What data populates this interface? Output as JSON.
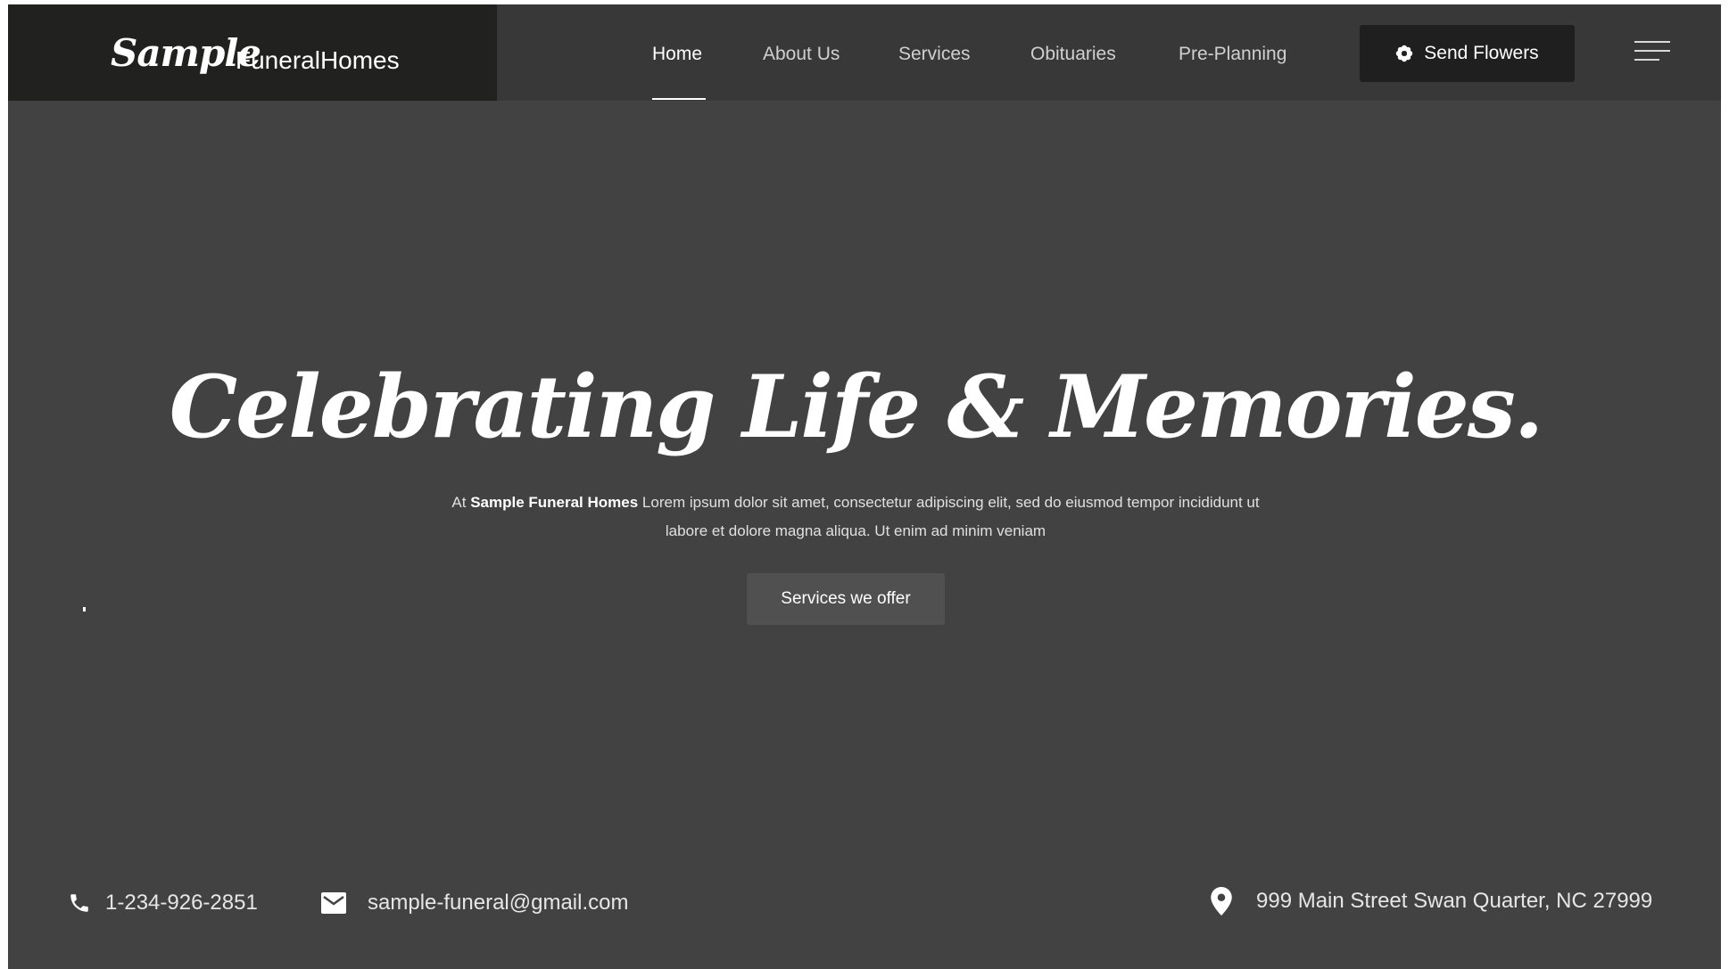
{
  "header": {
    "logo_script": "Sample",
    "logo_text": "FuneralHomes",
    "nav": [
      {
        "label": "Home",
        "active": true
      },
      {
        "label": "About Us"
      },
      {
        "label": "Services"
      },
      {
        "label": "Obituaries"
      },
      {
        "label": "Pre-Planning"
      }
    ],
    "send_flowers_label": "Send Flowers",
    "send_flowers_icon": "flower-icon",
    "menu_icon": "hamburger-menu-icon"
  },
  "hero": {
    "title": "Celebrating Life & Memories.",
    "desc_prefix": "At ",
    "desc_brand": "Sample Funeral Homes",
    "desc_rest": " Lorem ipsum dolor sit amet, consectetur adipiscing elit, sed do eiusmod tempor incididunt ut labore et dolore magna aliqua. Ut enim ad minim veniam",
    "cta_label": "Services we offer"
  },
  "contact": {
    "phone": "1-234-926-2851",
    "phone_icon": "phone-icon",
    "email": "sample-funeral@gmail.com",
    "email_icon": "mail-icon",
    "address": "999 Main Street Swan Quarter, NC 27999",
    "address_icon": "location-pin-icon"
  },
  "colors": {
    "background": "#424242",
    "navbar": "#383838",
    "logo_box": "#212120",
    "button_dark": "#1f1f1f",
    "cta": "#505050"
  }
}
